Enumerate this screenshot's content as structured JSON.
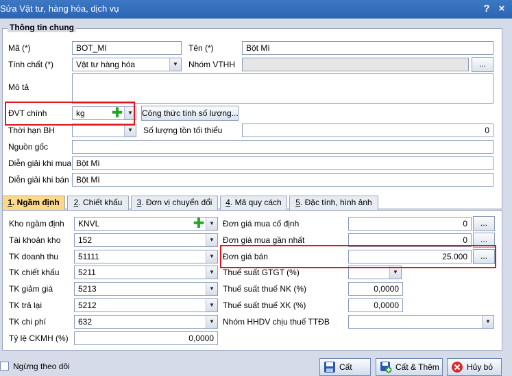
{
  "window": {
    "title": "Sửa Vật tư, hàng hóa, dịch vụ",
    "help": "?",
    "close": "×"
  },
  "general": {
    "title": "Thông tin chung",
    "ma_label": "Mã (*)",
    "ma_value": "BOT_MI",
    "ten_label": "Tên (*)",
    "ten_value": "Bột Mì",
    "tinhchat_label": "Tính chất (*)",
    "tinhchat_value": "Vật tư hàng hóa",
    "nhom_label": "Nhóm VTHH",
    "nhom_value": "",
    "mota_label": "Mô tả",
    "mota_value": "",
    "dvt_label": "ĐVT chính",
    "dvt_value": "kg",
    "congthuc_label": "Công thức tính số lượng...",
    "thoihan_label": "Thời hạn BH",
    "thoihan_value": "",
    "tonmin_label": "Số lượng tồn tối thiểu",
    "tonmin_value": "0",
    "nguongoc_label": "Nguồn gốc",
    "nguongoc_value": "",
    "diengiaimua_label": "Diễn giải khi mua",
    "diengiaimua_value": "Bột Mì",
    "diengiaiban_label": "Diễn giải khi bán",
    "diengiaiban_value": "Bột Mì",
    "ellipsis": "..."
  },
  "tabs": [
    {
      "num": "1",
      "label": ". Ngầm định"
    },
    {
      "num": "2",
      "label": ". Chiết khấu"
    },
    {
      "num": "3",
      "label": ". Đơn vị chuyển đổi"
    },
    {
      "num": "4",
      "label": ". Mã quy cách"
    },
    {
      "num": "5",
      "label": ". Đặc tính, hình ảnh"
    }
  ],
  "defaults": {
    "kho_label": "Kho ngầm định",
    "kho_value": "KNVL",
    "tkkho_label": "Tài khoản kho",
    "tkkho_value": "152",
    "tkdt_label": "TK doanh thu",
    "tkdt_value": "51111",
    "tkck_label": "TK chiết khấu",
    "tkck_value": "5211",
    "tkgg_label": "TK giảm giá",
    "tkgg_value": "5213",
    "tktl_label": "TK trả lại",
    "tktl_value": "5212",
    "tkcp_label": "TK chi phí",
    "tkcp_value": "632",
    "ckmh_label": "Tỷ lệ CKMH (%)",
    "ckmh_value": "0,0000",
    "dgmuacd_label": "Đơn giá mua cố định",
    "dgmuacd_value": "0",
    "dgmuagn_label": "Đơn giá mua gần nhất",
    "dgmuagn_value": "0",
    "dgban_label": "Đơn giá bán",
    "dgban_value": "25.000",
    "gtgt_label": "Thuế suất GTGT (%)",
    "gtgt_value": "",
    "nk_label": "Thuế suất thuế NK (%)",
    "nk_value": "0,0000",
    "xk_label": "Thuế suất thuế XK (%)",
    "xk_value": "0,0000",
    "ttdb_label": "Nhóm HHDV chịu thuế TTĐB",
    "ttdb_value": ""
  },
  "footer": {
    "ngung_label": "Ngừng theo dõi",
    "cat_label": "Cất",
    "catthem_label": "Cất & Thêm",
    "huybo_label": "Hủy bỏ"
  },
  "colors": {
    "highlight": "#e0151b",
    "tab_active": "#fbd989",
    "titlebar": "#2b64b3"
  }
}
